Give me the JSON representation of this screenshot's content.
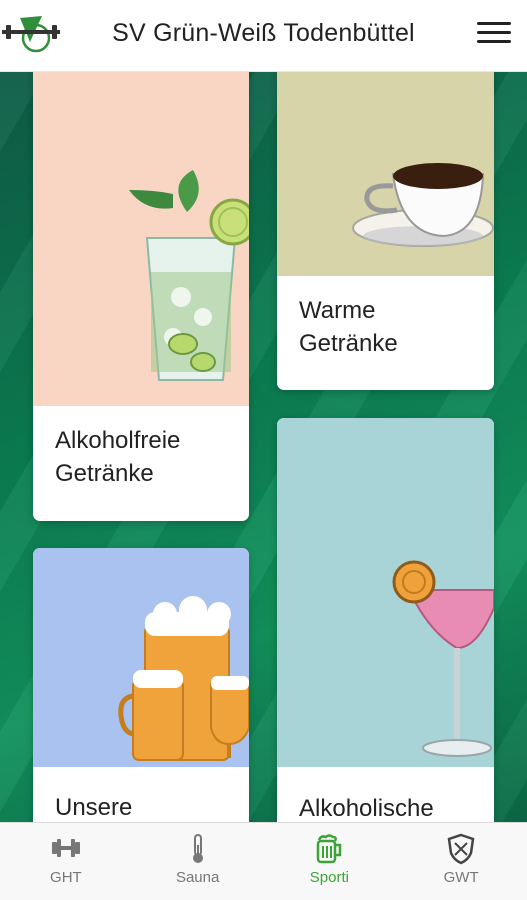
{
  "header": {
    "title": "SV Grün-Weiß Todenbüttel"
  },
  "tiles": {
    "alkoholfrei": {
      "line1": "Alkoholfreie",
      "line2": "Getränke",
      "bg": "#f9d6c3"
    },
    "warm": {
      "line1": "Warme",
      "line2": "Getränke",
      "bg": "#d6d4a8"
    },
    "unsere": {
      "line1": "Unsere",
      "bg": "#a9c2ef"
    },
    "alkoholisch": {
      "line1": "Alkoholische",
      "bg": "#a8d4d8"
    }
  },
  "tabbar": {
    "tabs": [
      {
        "label": "GHT",
        "icon": "dumbbell-icon"
      },
      {
        "label": "Sauna",
        "icon": "thermometer-icon"
      },
      {
        "label": "Sporti",
        "icon": "beer-mug-icon",
        "active": true
      },
      {
        "label": "GWT",
        "icon": "shield-icon"
      }
    ]
  },
  "colors": {
    "accent": "#3aa535",
    "background_green": "#0b7d52"
  }
}
